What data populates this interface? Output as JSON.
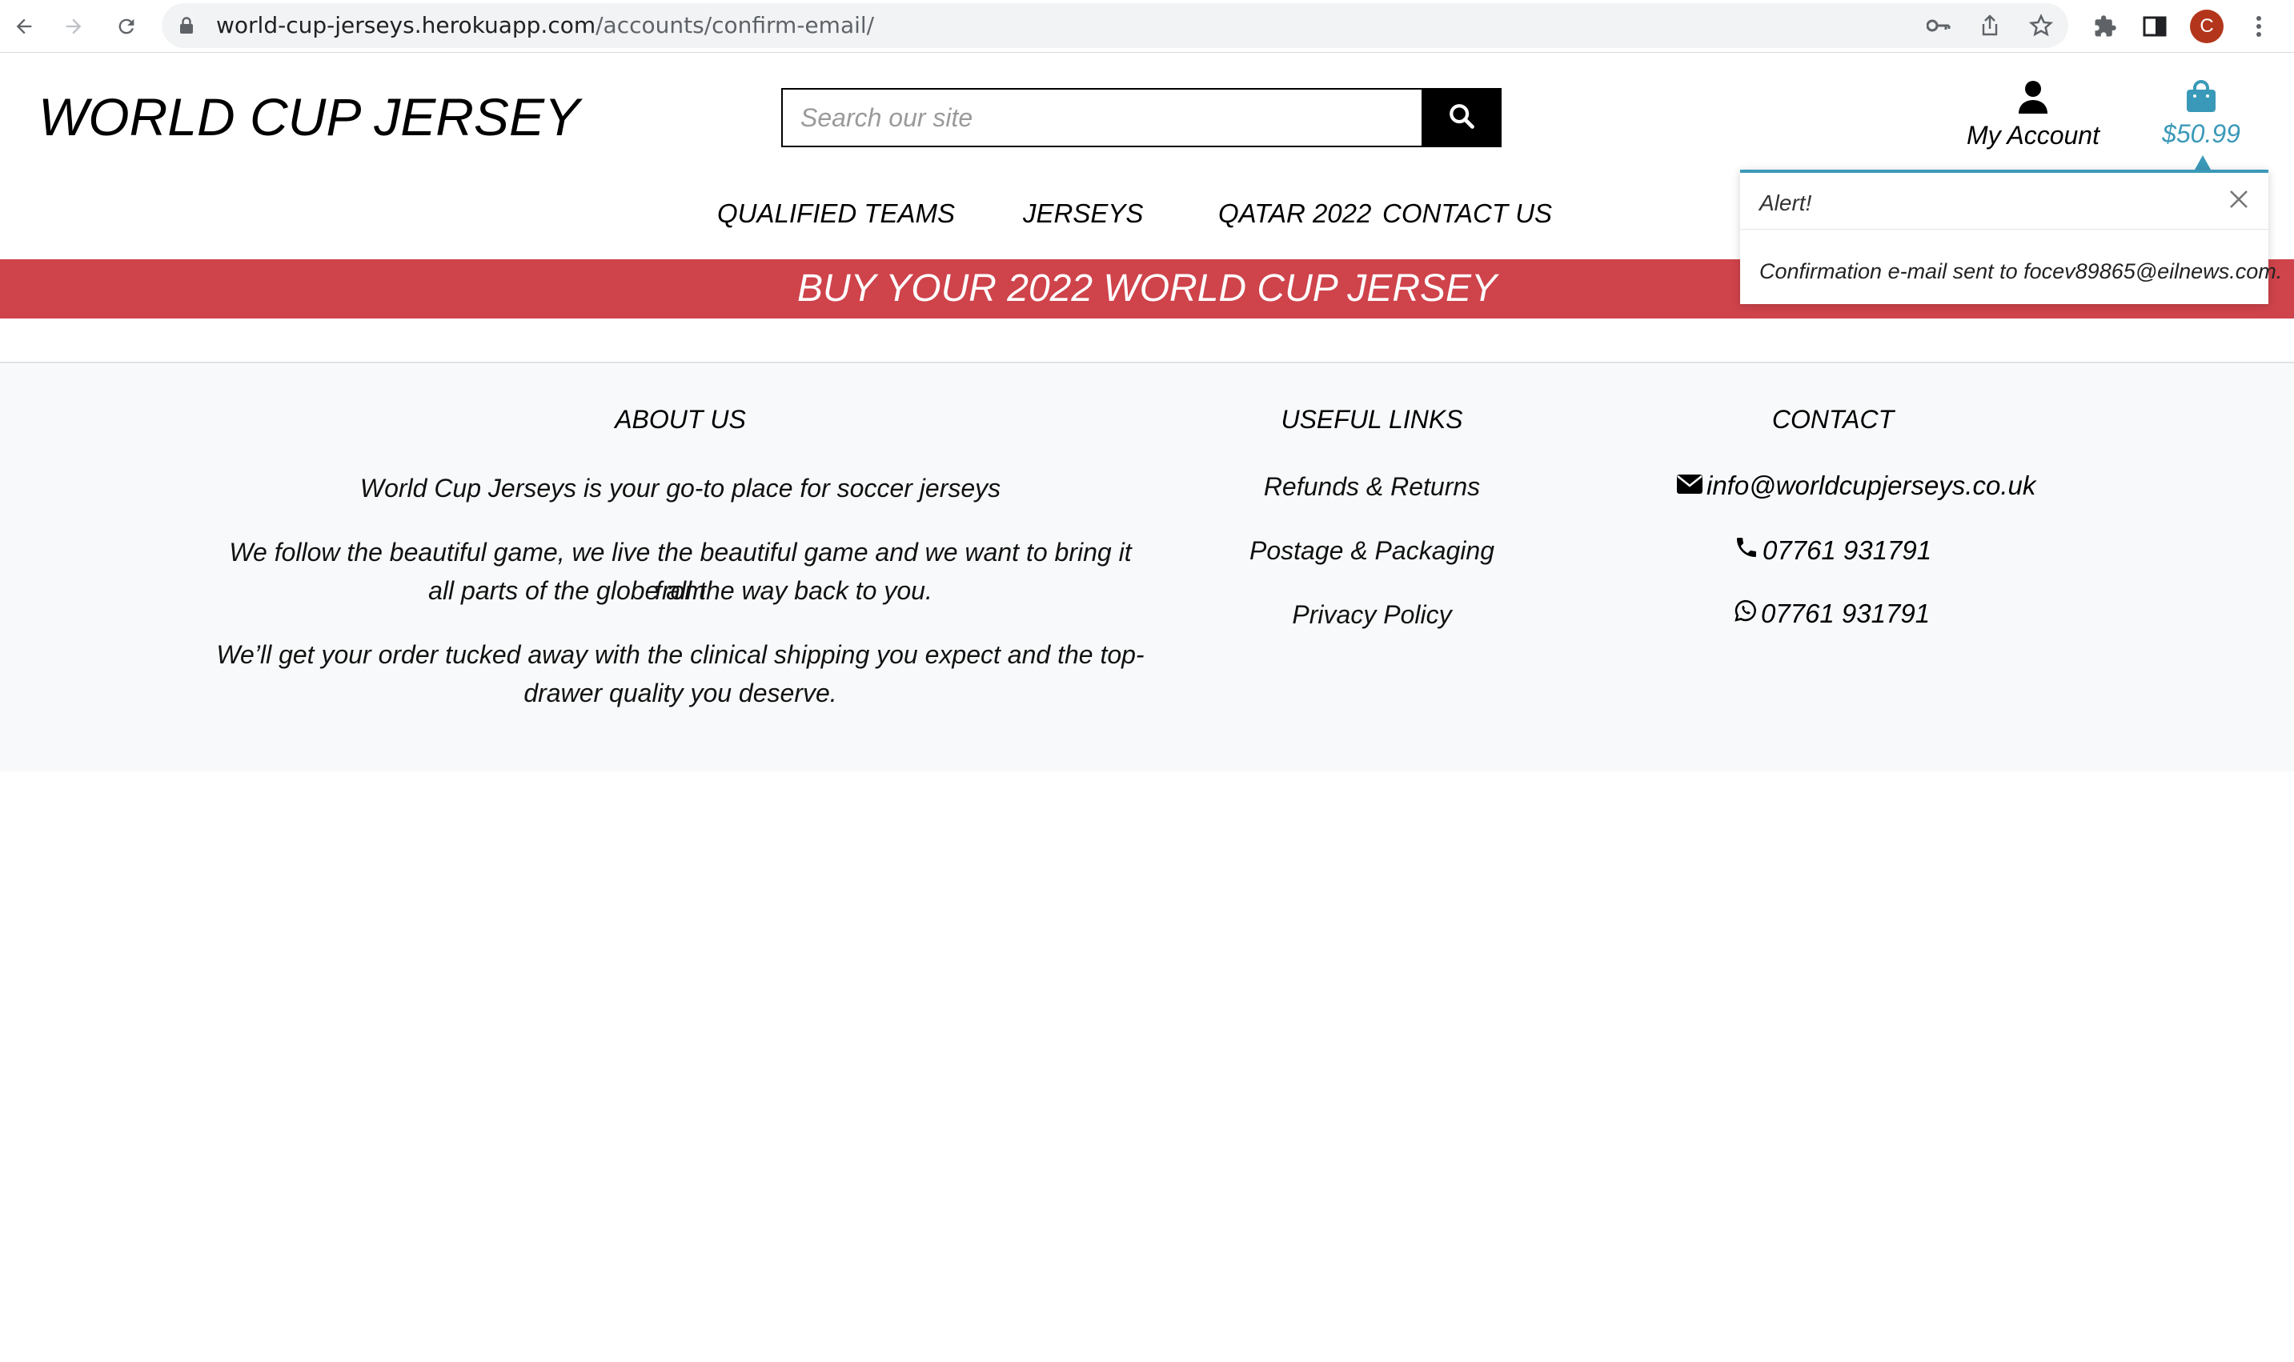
{
  "browser": {
    "url_host": "world-cup-jerseys.herokuapp.com",
    "url_path": "/accounts/confirm-email/",
    "profile_initial": "C"
  },
  "header": {
    "logo": "WORLD CUP JERSEY",
    "search_placeholder": "Search our site",
    "account_label": "My Account",
    "bag_total": "$50.99"
  },
  "nav": {
    "items": [
      "QUALIFIED TEAMS",
      "JERSEYS",
      "QATAR 2022",
      "CONTACT US"
    ]
  },
  "banner": {
    "text": "BUY YOUR 2022 WORLD CUP JERSEY"
  },
  "toast": {
    "title": "Alert!",
    "message": "Confirmation e-mail sent to focev89865@eilnews.com."
  },
  "footer": {
    "about": {
      "title": "ABOUT US",
      "p1": "World Cup Jerseys is your go-to place for soccer jerseys",
      "p2_l1": "We follow the beautiful game, we live the beautiful game and we want to bring it from",
      "p2_l2": "all parts of the globe all the way back to you.",
      "p3_l1": "We’ll get your order tucked away with the clinical shipping you expect and the top-",
      "p3_l2": "drawer quality you deserve."
    },
    "links": {
      "title": "USEFUL LINKS",
      "items": [
        "Refunds & Returns",
        "Postage & Packaging",
        "Privacy Policy"
      ]
    },
    "contact": {
      "title": "CONTACT",
      "email": "info@worldcupjerseys.co.uk",
      "phone": "07761 931791",
      "whatsapp": "07761 931791"
    }
  },
  "colors": {
    "banner": "#cf434b",
    "accent": "#3a99b8",
    "footer_bg": "#f8f9fa"
  }
}
